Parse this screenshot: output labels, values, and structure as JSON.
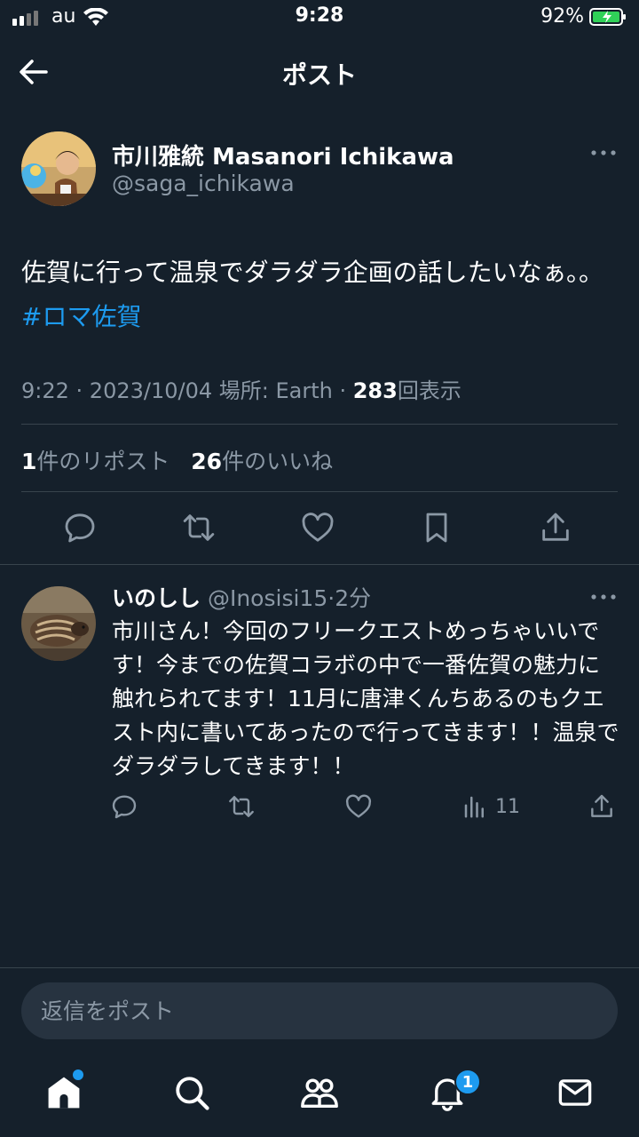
{
  "status_bar": {
    "carrier": "au",
    "time": "9:28",
    "battery_percent": "92%"
  },
  "header": {
    "title": "ポスト"
  },
  "tweet": {
    "author_name": "市川雅統 Masanori Ichikawa",
    "author_handle": "@saga_ichikawa",
    "text": "佐賀に行って温泉でダラダラ企画の話したいなぁ。。",
    "hashtag": "#ロマ佐賀",
    "time": "9:22",
    "date": "2023/10/04",
    "location_label": "場所: Earth",
    "view_count": "283",
    "view_label": "回表示",
    "repost_count": "1",
    "repost_label": "件のリポスト",
    "like_count": "26",
    "like_label": "件のいいね"
  },
  "reply": {
    "author_name": "いのしし",
    "author_handle": "@Inosisi15",
    "time_ago": "2分",
    "text": "市川さん！今回のフリークエストめっちゃいいです！今までの佐賀コラボの中で一番佐賀の魅力に触れられてます！11月に唐津くんちあるのもクエスト内に書いてあったので行ってきます！！温泉でダラダラしてきます！！",
    "view_count": "11"
  },
  "reply_box": {
    "placeholder": "返信をポスト"
  },
  "tabbar": {
    "notification_badge": "1"
  },
  "colors": {
    "background": "#15202b",
    "accent": "#1d9bf0",
    "secondary_text": "#8b98a5",
    "divider": "#38444d"
  }
}
